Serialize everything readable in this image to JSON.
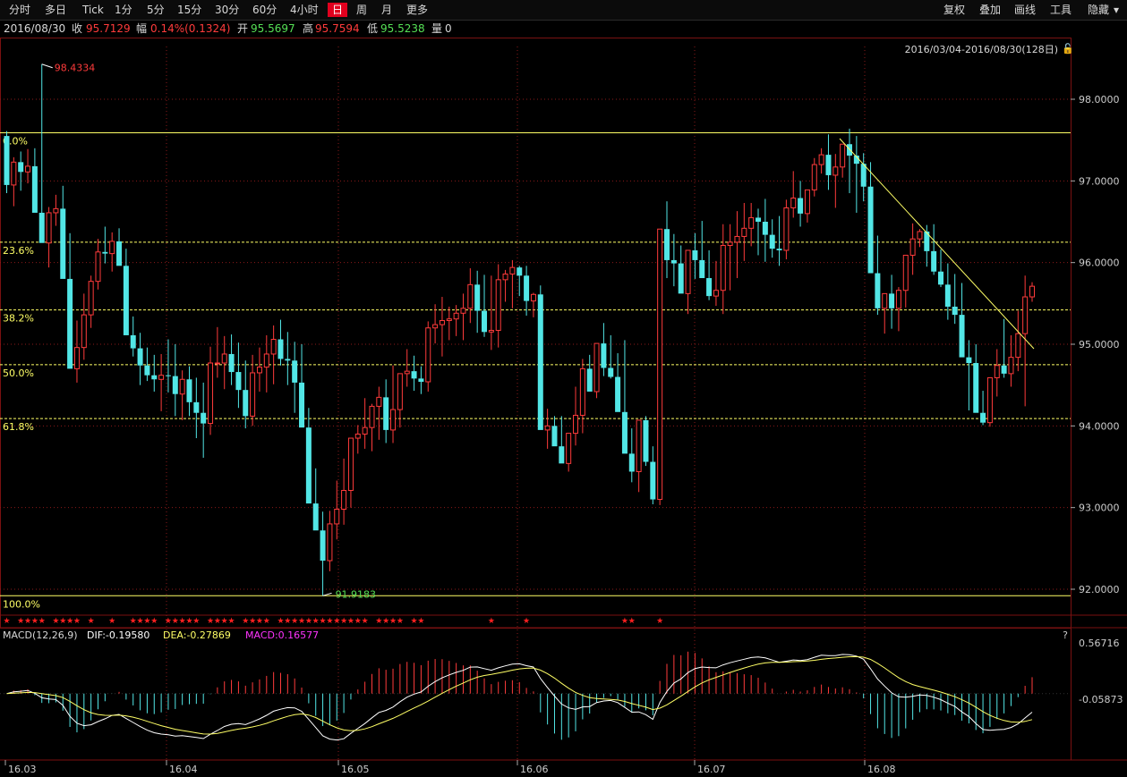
{
  "toolbar": {
    "periods": [
      "分时",
      "多日",
      "Tick",
      "1分",
      "5分",
      "15分",
      "30分",
      "60分",
      "4小时",
      "日",
      "周",
      "月",
      "更多"
    ],
    "active": "日",
    "right": [
      "复权",
      "叠加",
      "画线",
      "工具",
      "隐藏"
    ]
  },
  "quote": {
    "date": "2016/08/30",
    "close_label": "收",
    "close": "95.7129",
    "change_label": "幅",
    "change": "0.14%(0.1324)",
    "open_label": "开",
    "open": "95.5697",
    "high_label": "高",
    "high": "95.7594",
    "low_label": "低",
    "low": "95.5238",
    "volume_label": "量",
    "volume": "0"
  },
  "range_label": "2016/03/04-2016/08/30(128日)",
  "colors": {
    "up": "#ff3b3b",
    "down": "#52e6e6",
    "grid": "#8b1a1a",
    "fib": "#ffff66",
    "dif": "#ffffff",
    "dea": "#ffff66",
    "macd_label": "#ff33ff"
  },
  "chart_data": {
    "type": "candlestick",
    "price_axis": {
      "min": 91.7,
      "max": 98.6,
      "ticks": [
        "98.0000",
        "97.0000",
        "96.0000",
        "95.0000",
        "94.0000",
        "93.0000",
        "92.0000"
      ]
    },
    "date_ticks": [
      "16.03",
      "16.04",
      "16.05",
      "16.06",
      "16.07",
      "16.08"
    ],
    "annotations": {
      "high": "98.4334",
      "low": "91.9183"
    },
    "fibonacci": [
      {
        "label": "0.0%",
        "value": 97.59
      },
      {
        "label": "23.6%",
        "value": 96.25
      },
      {
        "label": "38.2%",
        "value": 95.42
      },
      {
        "label": "50.0%",
        "value": 94.75
      },
      {
        "label": "61.8%",
        "value": 94.09
      },
      {
        "label": "100.0%",
        "value": 91.92
      }
    ],
    "candles": [
      [
        97.55,
        97.61,
        96.85,
        96.95
      ],
      [
        96.95,
        97.29,
        96.69,
        97.23
      ],
      [
        97.23,
        97.36,
        96.88,
        97.11
      ],
      [
        97.11,
        97.39,
        96.97,
        97.18
      ],
      [
        97.18,
        97.4,
        96.84,
        96.61
      ],
      [
        96.61,
        98.43,
        96.53,
        96.24
      ],
      [
        96.24,
        96.68,
        95.94,
        96.61
      ],
      [
        96.61,
        96.83,
        96.45,
        96.66
      ],
      [
        96.66,
        96.94,
        95.9,
        95.8
      ],
      [
        95.8,
        96.36,
        95.33,
        94.7
      ],
      [
        94.7,
        95.29,
        94.53,
        94.96
      ],
      [
        94.96,
        95.62,
        94.81,
        95.36
      ],
      [
        95.36,
        95.84,
        95.2,
        95.77
      ],
      [
        95.77,
        96.29,
        95.67,
        96.13
      ],
      [
        96.13,
        96.44,
        95.99,
        96.11
      ],
      [
        96.11,
        96.37,
        95.89,
        96.26
      ],
      [
        96.26,
        96.42,
        95.99,
        95.96
      ],
      [
        95.96,
        96.17,
        95.15,
        95.11
      ],
      [
        95.11,
        95.34,
        94.85,
        94.95
      ],
      [
        94.95,
        95.14,
        94.5,
        94.74
      ],
      [
        94.74,
        94.96,
        94.55,
        94.62
      ],
      [
        94.62,
        94.87,
        94.42,
        94.57
      ],
      [
        94.57,
        94.88,
        94.18,
        94.62
      ],
      [
        94.62,
        95.06,
        94.41,
        94.61
      ],
      [
        94.61,
        95.0,
        94.12,
        94.39
      ],
      [
        94.39,
        94.68,
        94.07,
        94.57
      ],
      [
        94.57,
        94.73,
        94.12,
        94.29
      ],
      [
        94.29,
        94.59,
        93.85,
        94.16
      ],
      [
        94.16,
        94.53,
        93.61,
        94.03
      ],
      [
        94.03,
        94.97,
        93.89,
        94.77
      ],
      [
        94.77,
        95.21,
        94.59,
        94.77
      ],
      [
        94.77,
        95.1,
        94.45,
        94.88
      ],
      [
        94.88,
        95.12,
        94.5,
        94.66
      ],
      [
        94.66,
        95.02,
        94.22,
        94.44
      ],
      [
        94.44,
        94.8,
        93.97,
        94.12
      ],
      [
        94.12,
        94.87,
        94.0,
        94.65
      ],
      [
        94.65,
        94.96,
        94.42,
        94.72
      ],
      [
        94.72,
        95.11,
        94.41,
        94.88
      ],
      [
        94.88,
        95.23,
        94.51,
        95.06
      ],
      [
        95.06,
        95.3,
        94.74,
        94.82
      ],
      [
        94.82,
        95.15,
        94.5,
        94.8
      ],
      [
        94.8,
        95.03,
        94.16,
        94.53
      ],
      [
        94.53,
        95.0,
        94.2,
        93.98
      ],
      [
        93.98,
        94.22,
        93.33,
        93.05
      ],
      [
        93.05,
        93.48,
        92.79,
        92.72
      ],
      [
        92.72,
        92.95,
        91.92,
        92.35
      ],
      [
        92.35,
        92.96,
        92.22,
        92.8
      ],
      [
        92.8,
        93.33,
        92.61,
        92.98
      ],
      [
        92.98,
        93.6,
        92.79,
        93.21
      ],
      [
        93.21,
        93.67,
        93.0,
        93.85
      ],
      [
        93.85,
        94.01,
        93.66,
        93.9
      ],
      [
        93.9,
        94.34,
        93.72,
        93.98
      ],
      [
        93.98,
        94.27,
        93.69,
        94.24
      ],
      [
        94.24,
        94.48,
        93.83,
        94.35
      ],
      [
        94.35,
        94.57,
        93.79,
        93.95
      ],
      [
        93.95,
        94.74,
        93.79,
        94.2
      ],
      [
        94.2,
        94.63,
        93.98,
        94.64
      ],
      [
        94.64,
        94.94,
        94.48,
        94.67
      ],
      [
        94.67,
        94.86,
        94.43,
        94.58
      ],
      [
        94.58,
        94.73,
        94.39,
        94.54
      ],
      [
        94.54,
        95.28,
        94.42,
        95.2
      ],
      [
        95.2,
        95.49,
        95.01,
        95.24
      ],
      [
        95.24,
        95.58,
        94.85,
        95.29
      ],
      [
        95.29,
        95.46,
        95.05,
        95.31
      ],
      [
        95.31,
        95.48,
        95.1,
        95.38
      ],
      [
        95.38,
        95.62,
        95.05,
        95.44
      ],
      [
        95.44,
        95.93,
        95.26,
        95.73
      ],
      [
        95.73,
        95.9,
        95.14,
        95.41
      ],
      [
        95.41,
        95.85,
        95.09,
        95.15
      ],
      [
        95.15,
        95.84,
        94.93,
        95.17
      ],
      [
        95.17,
        95.98,
        94.96,
        95.79
      ],
      [
        95.79,
        95.91,
        95.52,
        95.86
      ],
      [
        95.86,
        96.03,
        95.44,
        95.94
      ],
      [
        95.94,
        95.96,
        95.59,
        95.84
      ],
      [
        95.84,
        95.96,
        95.35,
        95.53
      ],
      [
        95.53,
        95.63,
        95.33,
        95.61
      ],
      [
        95.61,
        95.72,
        94.05,
        93.95
      ],
      [
        93.95,
        94.21,
        93.72,
        94.0
      ],
      [
        94.0,
        94.12,
        93.79,
        93.75
      ],
      [
        93.75,
        94.12,
        93.55,
        93.54
      ],
      [
        93.54,
        93.9,
        93.44,
        93.91
      ],
      [
        93.91,
        94.48,
        93.76,
        94.13
      ],
      [
        94.13,
        94.82,
        93.91,
        94.7
      ],
      [
        94.7,
        94.87,
        94.45,
        94.42
      ],
      [
        94.42,
        94.97,
        94.34,
        95.01
      ],
      [
        95.01,
        95.26,
        94.61,
        94.71
      ],
      [
        94.71,
        95.11,
        94.58,
        94.6
      ],
      [
        94.6,
        94.89,
        94.31,
        94.17
      ],
      [
        94.17,
        95.05,
        94.09,
        93.66
      ],
      [
        93.66,
        93.97,
        93.31,
        93.44
      ],
      [
        93.44,
        94.06,
        93.19,
        94.07
      ],
      [
        94.07,
        94.12,
        93.51,
        93.56
      ],
      [
        93.56,
        93.75,
        93.04,
        93.1
      ],
      [
        93.1,
        95.49,
        93.03,
        96.41
      ],
      [
        96.41,
        96.75,
        95.81,
        96.03
      ],
      [
        96.03,
        96.35,
        95.71,
        95.99
      ],
      [
        95.99,
        96.21,
        95.77,
        95.62
      ],
      [
        95.62,
        96.03,
        95.37,
        96.15
      ],
      [
        96.15,
        96.36,
        95.8,
        96.03
      ],
      [
        96.03,
        96.51,
        95.88,
        95.81
      ],
      [
        95.81,
        96.15,
        95.54,
        95.59
      ],
      [
        95.59,
        96.02,
        95.47,
        95.66
      ],
      [
        95.66,
        96.47,
        95.37,
        96.21
      ],
      [
        96.21,
        96.47,
        95.66,
        96.25
      ],
      [
        96.25,
        96.63,
        95.81,
        96.32
      ],
      [
        96.32,
        96.73,
        96.02,
        96.42
      ],
      [
        96.42,
        96.73,
        96.2,
        96.55
      ],
      [
        96.55,
        96.66,
        96.09,
        96.5
      ],
      [
        96.5,
        96.78,
        96.01,
        96.34
      ],
      [
        96.34,
        96.53,
        96.06,
        96.17
      ],
      [
        96.17,
        96.57,
        95.96,
        96.15
      ],
      [
        96.15,
        96.77,
        96.04,
        96.67
      ],
      [
        96.67,
        97.12,
        96.55,
        96.79
      ],
      [
        96.79,
        97.0,
        96.44,
        96.6
      ],
      [
        96.6,
        96.77,
        96.49,
        96.89
      ],
      [
        96.89,
        97.28,
        96.81,
        97.2
      ],
      [
        97.2,
        97.4,
        97.09,
        97.32
      ],
      [
        97.32,
        97.57,
        96.89,
        97.07
      ],
      [
        97.07,
        97.33,
        96.67,
        97.17
      ],
      [
        97.17,
        97.42,
        97.04,
        97.45
      ],
      [
        97.45,
        97.64,
        96.85,
        97.31
      ],
      [
        97.31,
        97.55,
        96.61,
        97.21
      ],
      [
        97.21,
        97.34,
        96.75,
        96.93
      ],
      [
        96.93,
        97.23,
        96.69,
        95.87
      ],
      [
        95.87,
        96.33,
        95.36,
        95.44
      ],
      [
        95.44,
        95.56,
        95.13,
        95.62
      ],
      [
        95.62,
        95.85,
        95.19,
        95.44
      ],
      [
        95.44,
        95.7,
        95.16,
        95.66
      ],
      [
        95.66,
        95.99,
        95.45,
        96.09
      ],
      [
        96.09,
        96.48,
        95.85,
        96.29
      ],
      [
        96.29,
        96.41,
        96.19,
        96.38
      ],
      [
        96.38,
        96.46,
        95.95,
        96.14
      ],
      [
        96.14,
        96.47,
        95.85,
        95.89
      ],
      [
        95.89,
        96.16,
        95.7,
        95.73
      ],
      [
        95.73,
        95.99,
        95.3,
        95.46
      ],
      [
        95.46,
        95.86,
        95.25,
        95.36
      ],
      [
        95.36,
        95.75,
        94.86,
        94.84
      ],
      [
        94.84,
        95.05,
        94.19,
        94.77
      ],
      [
        94.77,
        95.0,
        94.57,
        94.16
      ],
      [
        94.16,
        94.43,
        94.01,
        94.04
      ],
      [
        94.04,
        94.56,
        93.99,
        94.59
      ],
      [
        94.59,
        94.94,
        94.36,
        94.74
      ],
      [
        94.74,
        95.31,
        94.59,
        94.64
      ],
      [
        94.64,
        95.11,
        94.48,
        94.84
      ],
      [
        94.84,
        95.41,
        94.67,
        95.13
      ],
      [
        95.13,
        95.84,
        94.24,
        95.58
      ],
      [
        95.58,
        95.76,
        95.52,
        95.71
      ]
    ],
    "macd": {
      "label": "MACD(12,26,9)",
      "dif_label": "DIF:-0.19580",
      "dea_label": "DEA:-0.27869",
      "macd_value_label": "MACD:0.16577",
      "axis_ticks": [
        "0.56716",
        "-0.05873"
      ],
      "axis_range": [
        -0.83,
        0.6
      ]
    }
  }
}
